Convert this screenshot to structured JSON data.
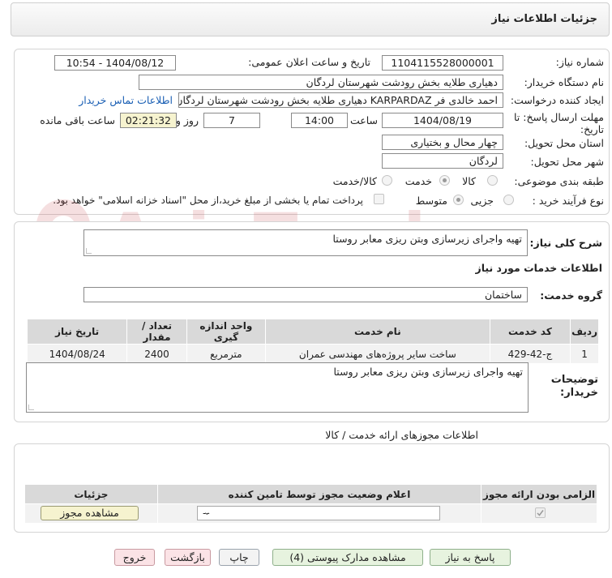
{
  "header": {
    "title": "جزئیات اطلاعات نیاز"
  },
  "details": {
    "need_number_label": "شماره نیاز:",
    "need_number": "1104115528000001",
    "announce_label": "تاریخ و ساعت اعلان عمومی:",
    "announce_value": "1404/08/12 - 10:54",
    "buyer_org_label": "نام دستگاه خریدار:",
    "buyer_org": "دهیاری طلایه بخش رودشت شهرستان لردگان",
    "creator_label": "ایجاد کننده درخواست:",
    "creator": "احمد خالدی فر KARPARDAZ دهیاری طلایه بخش رودشت شهرستان لردگان",
    "contact_link": "اطلاعات تماس خریدار",
    "deadline_label": "مهلت ارسال پاسخ: تا تاریخ:",
    "deadline_date": "1404/08/19",
    "time_label": "ساعت",
    "deadline_time": "14:00",
    "days": "7",
    "days_label": "روز و",
    "remaining": "02:21:32",
    "remaining_label": "ساعت باقی مانده",
    "province_label": "استان محل تحویل:",
    "province": "چهار محال و بختیاری",
    "city_label": "شهر محل تحویل:",
    "city": "لردگان",
    "category_label": "طبقه بندی موضوعی:",
    "category_options": [
      "کالا",
      "خدمت",
      "کالا/خدمت"
    ],
    "process_label": "نوع فرآیند خرید :",
    "process_options": [
      "جزیی",
      "متوسط"
    ],
    "payment_note": "پرداخت تمام یا بخشی از مبلغ خرید،از محل \"اسناد خزانه اسلامی\" خواهد بود."
  },
  "general": {
    "desc_label": "شرح کلی نیاز:",
    "desc": "تهیه واجرای زیرسازی وبتن ریزی معابر روستا",
    "services_title": "اطلاعات خدمات مورد نیاز",
    "group_label": "گروه خدمت:",
    "group": "ساختمان"
  },
  "table": {
    "headers": [
      "ردیف",
      "کد خدمت",
      "نام خدمت",
      "واحد اندازه گیری",
      "تعداد / مقدار",
      "تاریخ نیاز"
    ],
    "rows": [
      [
        "1",
        "ج-42-429",
        "ساخت سایر پروژه‌های مهندسی عمران",
        "مترمربع",
        "2400",
        "1404/08/24"
      ]
    ]
  },
  "buyer_notes": {
    "label": "توضیحات خریدار:",
    "text": "تهیه واجرای زیرسازی وبتن ریزی معابر روستا"
  },
  "permits": {
    "section_title": "اطلاعات مجوزهای ارائه خدمت / کالا",
    "headers": [
      "الزامی بودن ارائه مجوز",
      "اعلام وضعیت مجوز توسط تامین کننده",
      "جزئیات"
    ],
    "select_value": "--",
    "view_button": "مشاهده مجوز"
  },
  "actions": {
    "reply": "پاسخ به نیاز",
    "attachments": "مشاهده مدارک پیوستی (4)",
    "print": "چاپ",
    "back": "بازگشت",
    "exit": "خروج"
  },
  "watermark": {
    "text": "AriaTender.neT"
  },
  "colors": {
    "link": "#1a5fb4",
    "watermark": "#c9474d"
  }
}
